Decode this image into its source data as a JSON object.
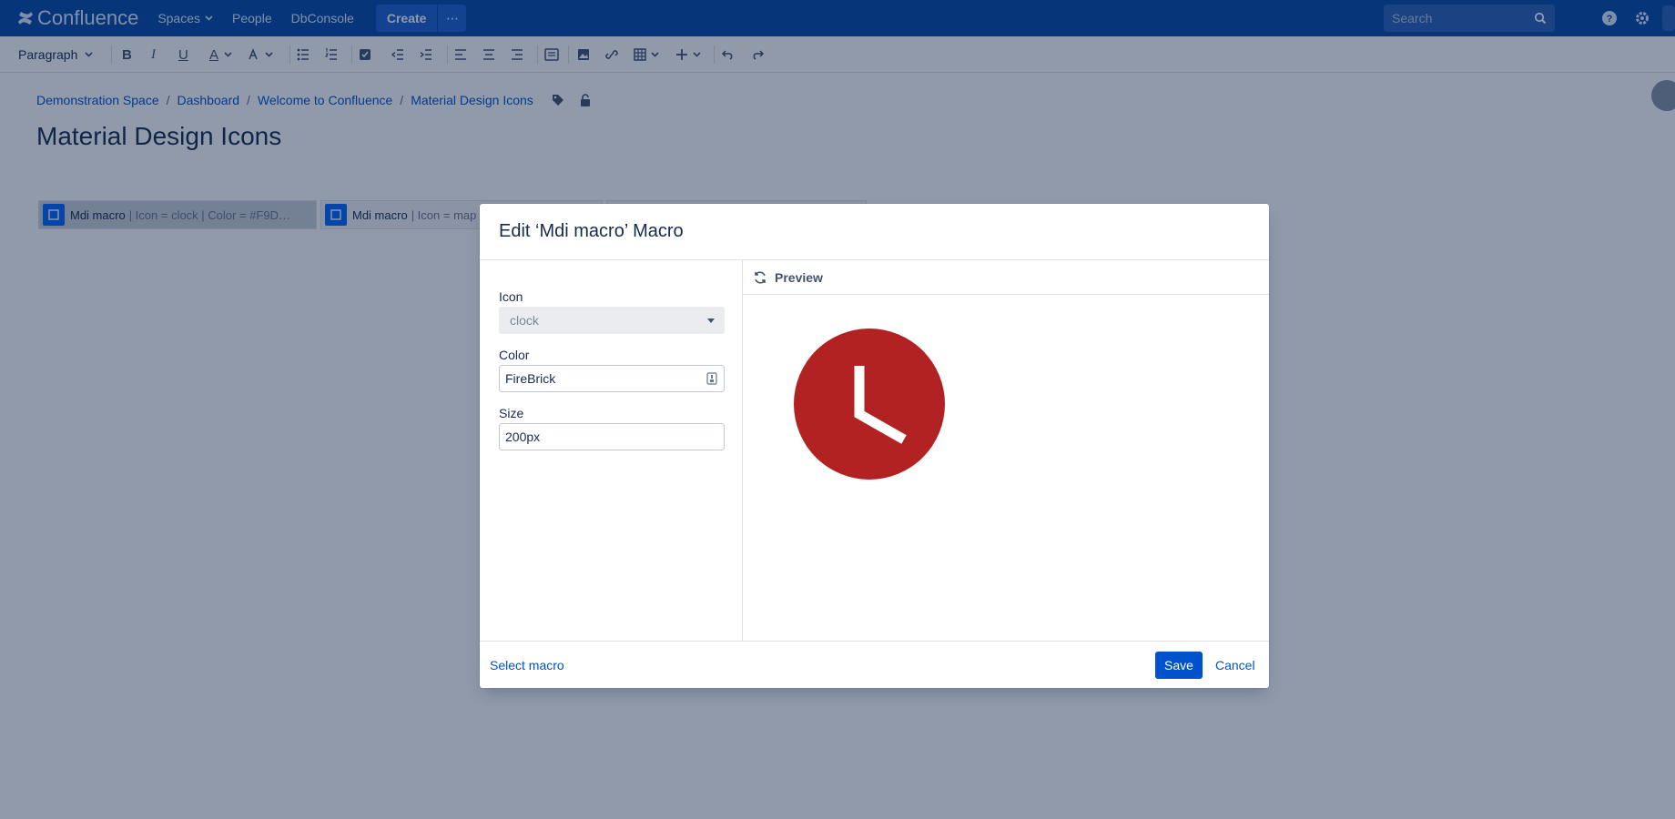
{
  "nav": {
    "logo_text": "Confluence",
    "items": [
      "Spaces",
      "People",
      "DbConsole"
    ],
    "create_label": "Create",
    "more_label": "⋯",
    "search_placeholder": "Search"
  },
  "toolbar": {
    "paragraph_label": "Paragraph",
    "bold": "B",
    "italic": "I",
    "underline": "U",
    "text_color": "A"
  },
  "breadcrumb": [
    "Demonstration Space",
    "Dashboard",
    "Welcome to Confluence",
    "Material Design Icons"
  ],
  "page_title": "Material Design Icons",
  "macros": [
    {
      "name": "Mdi macro",
      "params": "| Icon = clock | Color = #F9D…"
    },
    {
      "name": "Mdi macro",
      "params": "| Icon = map"
    }
  ],
  "dialog": {
    "title": "Edit ‘Mdi macro’ Macro",
    "icon_label": "Icon",
    "icon_value": "clock",
    "color_label": "Color",
    "color_value": "FireBrick",
    "size_label": "Size",
    "size_value": "200px",
    "preview_label": "Preview",
    "preview_color": "#b22222",
    "select_macro_label": "Select macro",
    "save_label": "Save",
    "cancel_label": "Cancel"
  },
  "colors": {
    "nav_bg": "#0747a6",
    "primary": "#0052cc",
    "firebrick": "#b22222"
  }
}
